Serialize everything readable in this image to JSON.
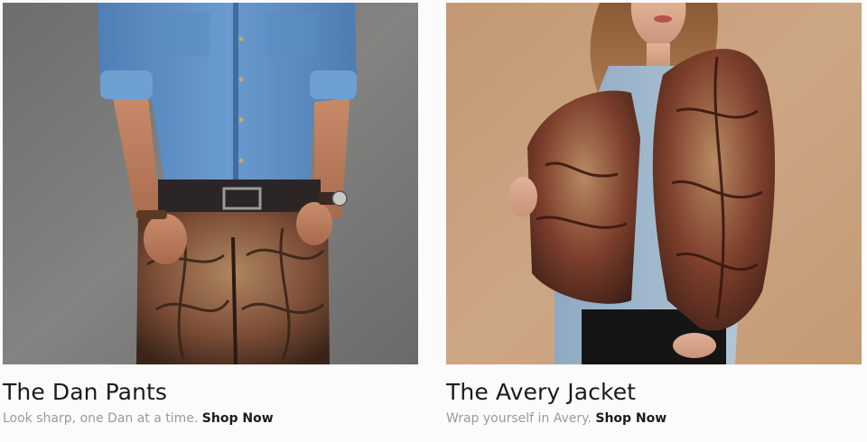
{
  "products": [
    {
      "title": "The Dan Pants",
      "tagline": "Look sharp, one Dan at a time.",
      "shop_label": "Shop Now",
      "image_description": "model wearing denim shirt and textured leather pants",
      "colors": {
        "background": "#7b7b7a",
        "shirt": "#5b8cc1",
        "item": "#7a4a33"
      }
    },
    {
      "title": "The Avery Jacket",
      "tagline": "Wrap yourself in Avery.",
      "shop_label": "Shop Now",
      "image_description": "model wearing textured leather jacket over chambray shirt",
      "colors": {
        "background": "#c9a07d",
        "shirt": "#9bb3c9",
        "item": "#7a3b2a"
      }
    }
  ]
}
